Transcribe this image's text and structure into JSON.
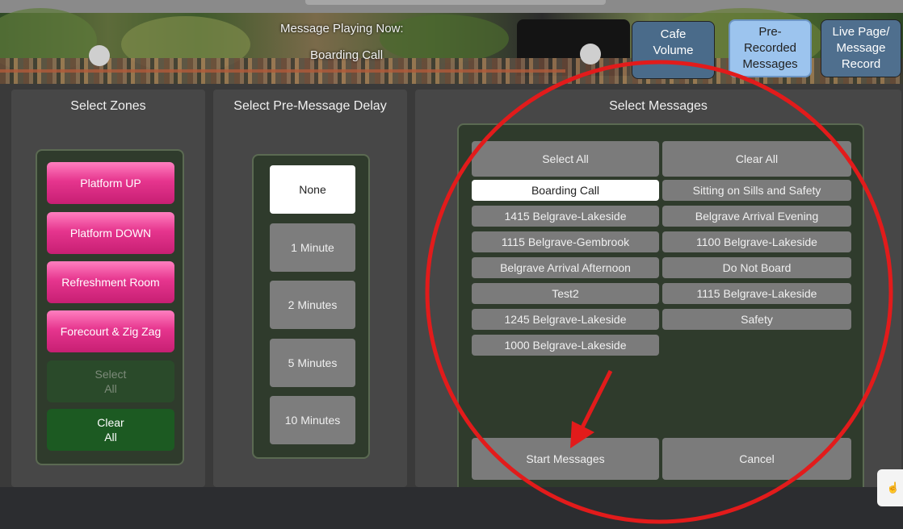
{
  "header": {
    "now_playing_label": "Message Playing Now:",
    "now_playing_value": "Boarding Call",
    "buttons": [
      {
        "label_lines": [
          "Cafe",
          "Volume"
        ]
      },
      {
        "label_lines": [
          "Pre-",
          "Recorded",
          "Messages"
        ]
      },
      {
        "label_lines": [
          "Live Page/",
          "Message",
          "Record"
        ]
      }
    ]
  },
  "zones": {
    "title": "Select Zones",
    "items": [
      "Platform UP",
      "Platform DOWN",
      "Refreshment Room",
      "Forecourt & Zig Zag"
    ],
    "select_all": [
      "Select",
      "All"
    ],
    "clear_all": [
      "Clear",
      "All"
    ]
  },
  "delay": {
    "title": "Select Pre-Message Delay",
    "options": [
      "None",
      "1 Minute",
      "2 Minutes",
      "5 Minutes",
      "10 Minutes"
    ],
    "selected": "None"
  },
  "messages": {
    "title": "Select Messages",
    "select_all": "Select All",
    "clear_all": "Clear All",
    "left": [
      "Boarding Call",
      "1415 Belgrave-Lakeside",
      "1115 Belgrave-Gembrook",
      "Belgrave Arrival Afternoon",
      "Test2",
      "1245 Belgrave-Lakeside",
      "1000 Belgrave-Lakeside"
    ],
    "right": [
      "Sitting on Sills and Safety",
      "Belgrave Arrival Evening",
      "1100 Belgrave-Lakeside",
      "Do Not Board",
      "1115 Belgrave-Lakeside",
      "Safety"
    ],
    "selected": "Boarding Call",
    "start": "Start Messages",
    "cancel": "Cancel"
  },
  "side_tab_icon": "hand-pointer-icon",
  "annotation": {
    "color": "#e21b1b"
  }
}
